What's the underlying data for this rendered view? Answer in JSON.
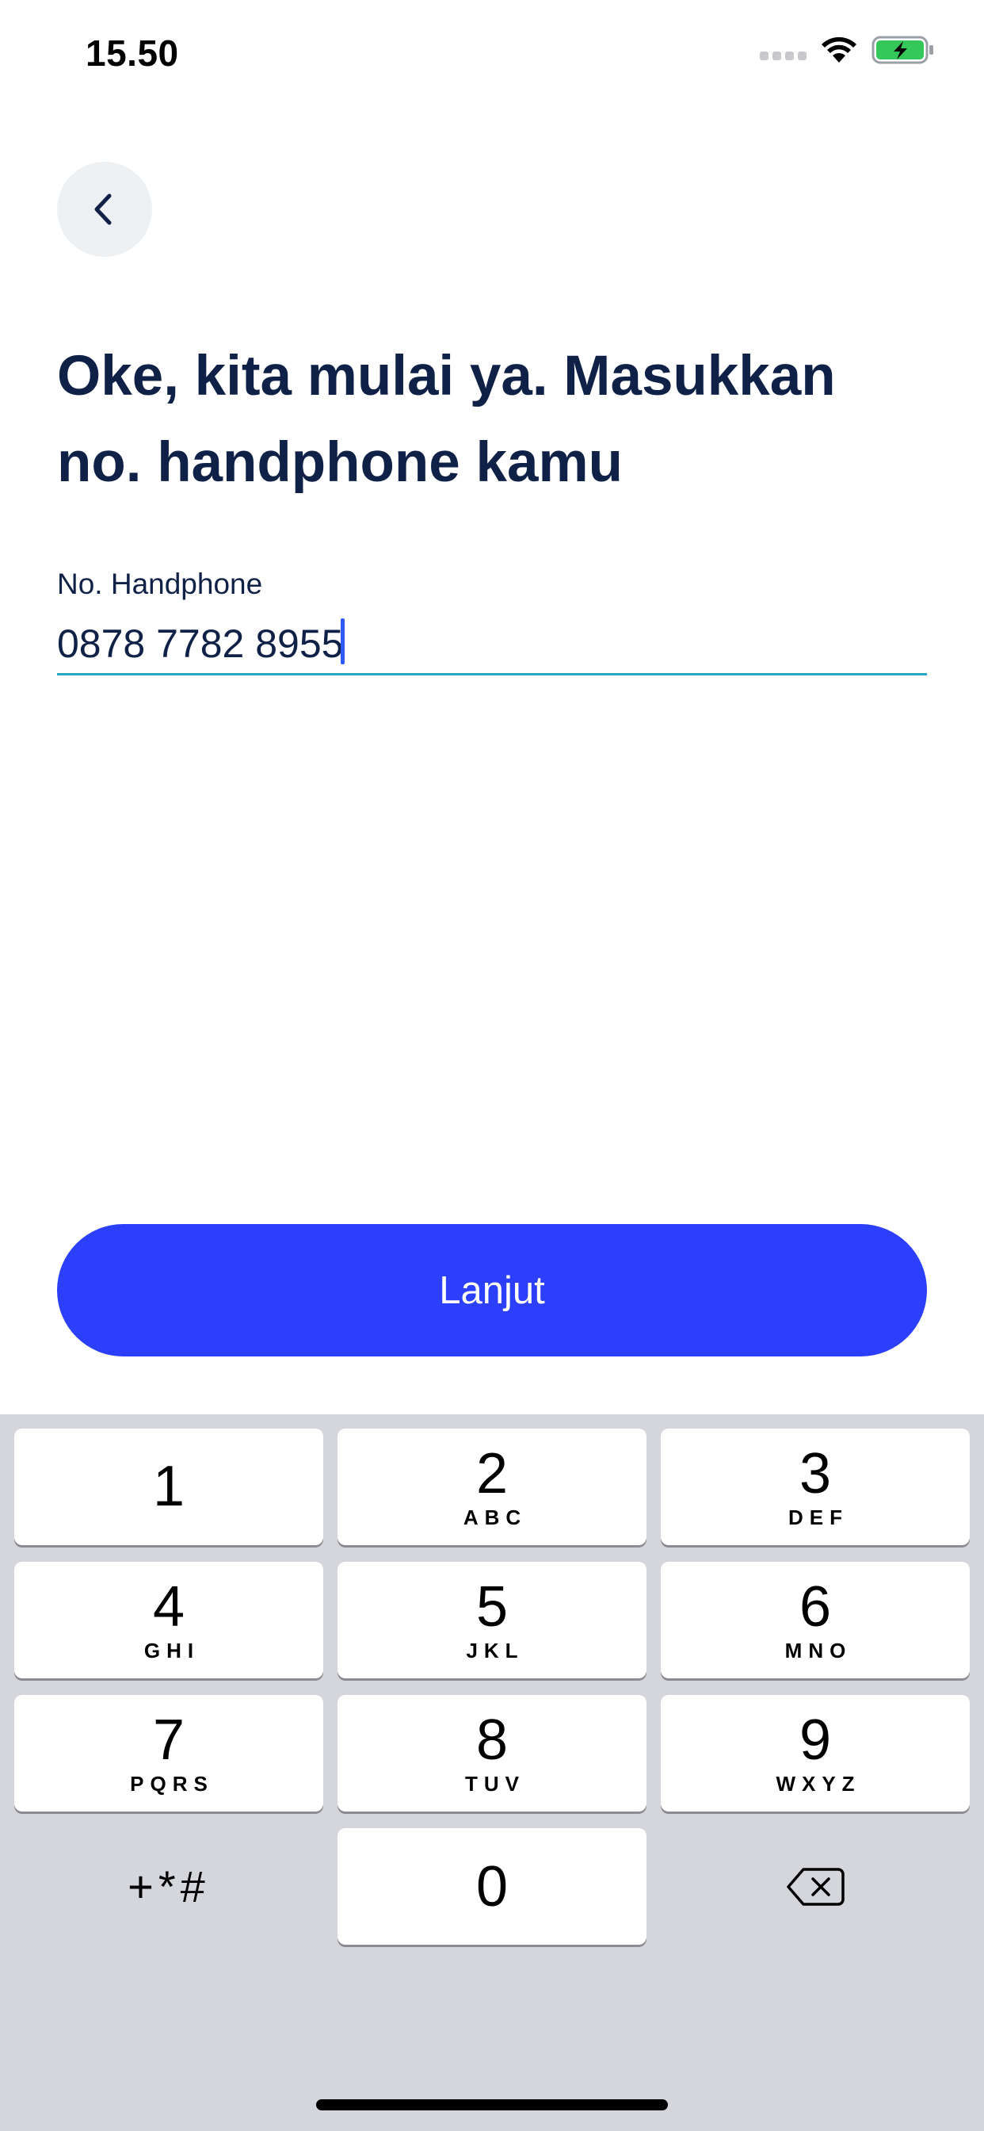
{
  "status_bar": {
    "time": "15.50",
    "icons": [
      "cellular-signal-icon",
      "wifi-icon",
      "battery-charging-icon"
    ],
    "battery_color": "#34c759"
  },
  "nav": {
    "back_icon": "chevron-left-icon"
  },
  "title": {
    "line1": "Oke, kita mulai ya. Masukkan",
    "line2": "no. handphone kamu"
  },
  "phone_field": {
    "label": "No. Handphone",
    "value": "0878 7782 8955"
  },
  "continue_button": {
    "label": "Lanjut"
  },
  "keypad": {
    "keys": [
      {
        "digit": "1",
        "letters": ""
      },
      {
        "digit": "2",
        "letters": "ABC"
      },
      {
        "digit": "3",
        "letters": "DEF"
      },
      {
        "digit": "4",
        "letters": "GHI"
      },
      {
        "digit": "5",
        "letters": "JKL"
      },
      {
        "digit": "6",
        "letters": "MNO"
      },
      {
        "digit": "7",
        "letters": "PQRS"
      },
      {
        "digit": "8",
        "letters": "TUV"
      },
      {
        "digit": "9",
        "letters": "WXYZ"
      },
      {
        "digit": "0",
        "letters": ""
      }
    ],
    "symbols_key": "+*#",
    "delete_icon": "backspace-icon"
  },
  "colors": {
    "primary": "#2b3ffc",
    "title_text": "#0f2147",
    "field_underline": "#22a8c8",
    "keypad_bg": "#d4d6dc"
  }
}
